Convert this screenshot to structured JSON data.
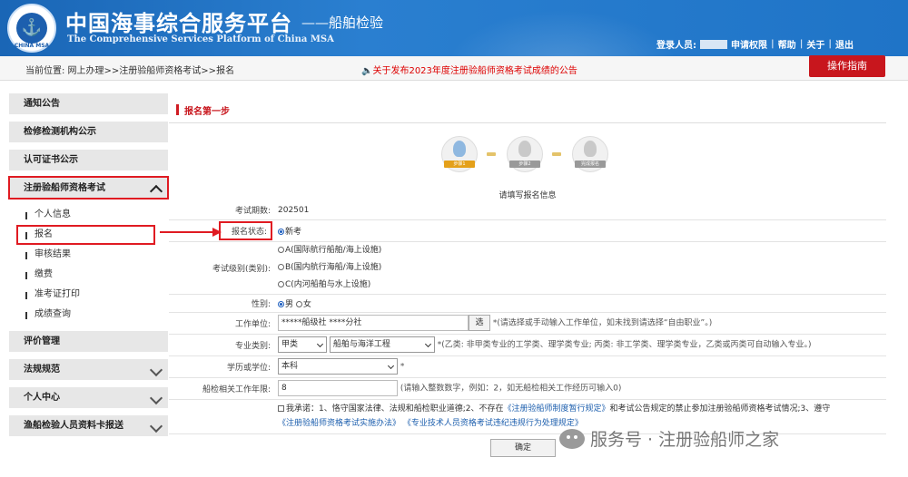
{
  "header": {
    "logo_text": "CHINA MSA",
    "title": "中国海事综合服务平台",
    "subtitle": "——船舶检验",
    "english": "The Comprehensive Services Platform of China MSA",
    "user_label": "登录人员:",
    "links": [
      "申请权限",
      "帮助",
      "关于",
      "退出"
    ]
  },
  "locbar": {
    "location": "当前位置:  网上办理>>注册验船师资格考试>>报名",
    "notice": "关于发布2023年度注册验船师资格考试成绩的公告",
    "guide_button": "操作指南"
  },
  "sidebar": {
    "items": [
      "通知公告",
      "检修检测机构公示",
      "认可证书公示",
      "注册验船师资格考试",
      "评价管理",
      "法规规范",
      "个人中心",
      "渔船检验人员资料卡报送"
    ],
    "sub_items": [
      "个人信息",
      "报名",
      "审核结果",
      "缴费",
      "准考证打印",
      "成绩查询"
    ]
  },
  "main": {
    "section_title": "报名第一步",
    "steps": [
      "步骤1",
      "步骤2",
      "完成报名"
    ],
    "form_title": "请填写报名信息",
    "rows": {
      "exam_period_label": "考试期数:",
      "exam_period_value": "202501",
      "status_label": "报名状态:",
      "status_option": "新考",
      "category_label": "考试级别(类别):",
      "category_options": [
        "A(国际航行船舶/海上设施)",
        "B(国内航行海船/海上设施)",
        "C(内河船舶与水上设施)"
      ],
      "gender_label": "性别:",
      "gender_options": [
        "男",
        "女"
      ],
      "work_unit_label": "工作单位:",
      "work_unit_value": "*****船级社    ****分社",
      "work_unit_button": "选",
      "work_unit_hint": "*(请选择或手动输入工作单位，如未找到请选择“自由职业”。)",
      "major_label": "专业类别:",
      "major_category": "甲类",
      "major_value": "船舶与海洋工程",
      "major_hint": "*(乙类: 非甲类专业的工学类、理学类专业; 丙类: 非工学类、理学类专业，乙类或丙类可自动输入专业。)",
      "degree_label": "学历或学位:",
      "degree_value": "本科",
      "degree_hint": "*",
      "years_label": "船检相关工作年限:",
      "years_value": "8",
      "years_hint": "(请输入整数数字，例如：2，如无船检相关工作经历可输入0)",
      "commit_line1_a": "我承诺：1、恪守国家法律、法规和船检职业道德;2、不存在",
      "commit_line1_b": "《注册验船师制度暂行规定》",
      "commit_line1_c": "和考试公告规定的禁止参加注册验船师资格考试情况;3、遵守",
      "commit_line2_a": "《注册验船师资格考试实施办法》",
      "commit_line2_b": "《专业技术人员资格考试违纪违规行为处理规定》",
      "confirm_button": "确定"
    }
  },
  "watermark": "服务号 · 注册验船师之家",
  "colors": {
    "header_blue": "#1f74c7",
    "accent_red": "#c8161d"
  }
}
